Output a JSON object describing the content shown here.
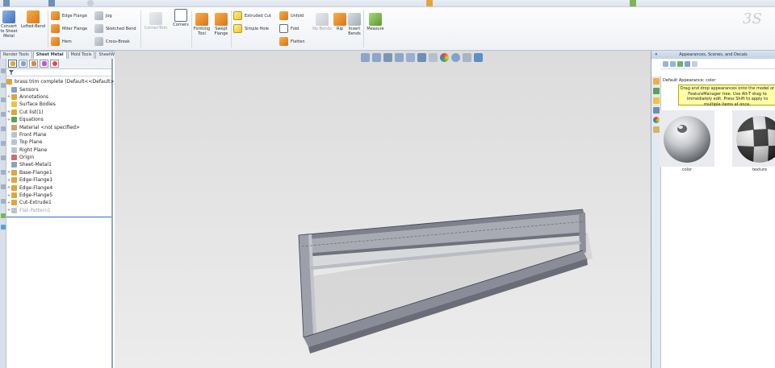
{
  "ribbon": {
    "convert_to_sheet_metal": "Convert to Sheet Metal",
    "lofted_bend": "Lofted-Bend",
    "edge_flange": "Edge Flange",
    "miter_flange": "Miter Flange",
    "hem": "Hem",
    "jog": "Jog",
    "sketched_bend": "Sketched Bend",
    "cross_break": "Cross-Break",
    "corner_trim": "Corner-Trim",
    "corners": "Corners",
    "forming_tool": "Forming Tool",
    "swept_flange": "Swept Flange",
    "extruded_cut": "Extruded Cut",
    "simple_hole": "Simple Hole",
    "unfold": "Unfold",
    "fold": "Fold",
    "flatten": "Flatten",
    "no_bends": "No Bends",
    "rip": "Rip",
    "insert_bends": "Insert Bends",
    "measure": "Measure",
    "logo": "3S"
  },
  "command_tabs": [
    "Render Tools",
    "Sheet Metal",
    "Mold Tools",
    "SheetWorks"
  ],
  "feature_manager": {
    "tab_icons": [
      "feature-manager-icon",
      "property-manager-icon",
      "configuration-manager-icon",
      "dimxpert-icon",
      "display-manager-icon"
    ],
    "filter_icon": "filter-icon",
    "root": "brass trim complete  (Default<<Default>_D",
    "items": [
      {
        "label": "Sensors",
        "icon": "sensors-icon",
        "expandable": false
      },
      {
        "label": "Annotations",
        "icon": "annotations-icon",
        "expandable": true
      },
      {
        "label": "Surface Bodies",
        "icon": "surface-bodies-icon",
        "expandable": false
      },
      {
        "label": "Cut list(1)",
        "icon": "cut-list-icon",
        "expandable": true
      },
      {
        "label": "Equations",
        "icon": "equations-icon",
        "expandable": true
      },
      {
        "label": "Material <not specified>",
        "icon": "material-icon",
        "expandable": false
      },
      {
        "label": "Front Plane",
        "icon": "plane-icon",
        "expandable": false
      },
      {
        "label": "Top Plane",
        "icon": "plane-icon",
        "expandable": false
      },
      {
        "label": "Right Plane",
        "icon": "plane-icon",
        "expandable": false
      },
      {
        "label": "Origin",
        "icon": "origin-icon",
        "expandable": false
      },
      {
        "label": "Sheet-Metal1",
        "icon": "sheet-metal-icon",
        "expandable": false
      },
      {
        "label": "Base-Flange1",
        "icon": "base-flange-icon",
        "expandable": true
      },
      {
        "label": "Edge-Flange1",
        "icon": "edge-flange-icon",
        "expandable": true
      },
      {
        "label": "Edge-Flange4",
        "icon": "edge-flange-icon",
        "expandable": true
      },
      {
        "label": "Edge-Flange5",
        "icon": "edge-flange-icon",
        "expandable": true
      },
      {
        "label": "Cut-Extrude1",
        "icon": "cut-extrude-icon",
        "expandable": true
      },
      {
        "label": "Flat-Pattern1",
        "icon": "flat-pattern-icon",
        "expandable": true,
        "suppressed": true
      }
    ]
  },
  "task_pane": {
    "title": "Appearances, Scenes, and Decals",
    "collapse_glyph": "«",
    "default_appearance": "Default Appearance: color",
    "tip": "Drag and drop appearances onto the model or FeatureManager tree.  Use Alt-T drag to immediately edit. Press Shift to apply to multiple items at once.",
    "swatches": [
      {
        "label": "color"
      },
      {
        "label": "texture"
      }
    ]
  },
  "colors": {
    "accent": "#2f6ccf",
    "tip_background": "#ffffa8",
    "viewport_background": "#e2e2e2",
    "model_face": "#9da0aa"
  }
}
